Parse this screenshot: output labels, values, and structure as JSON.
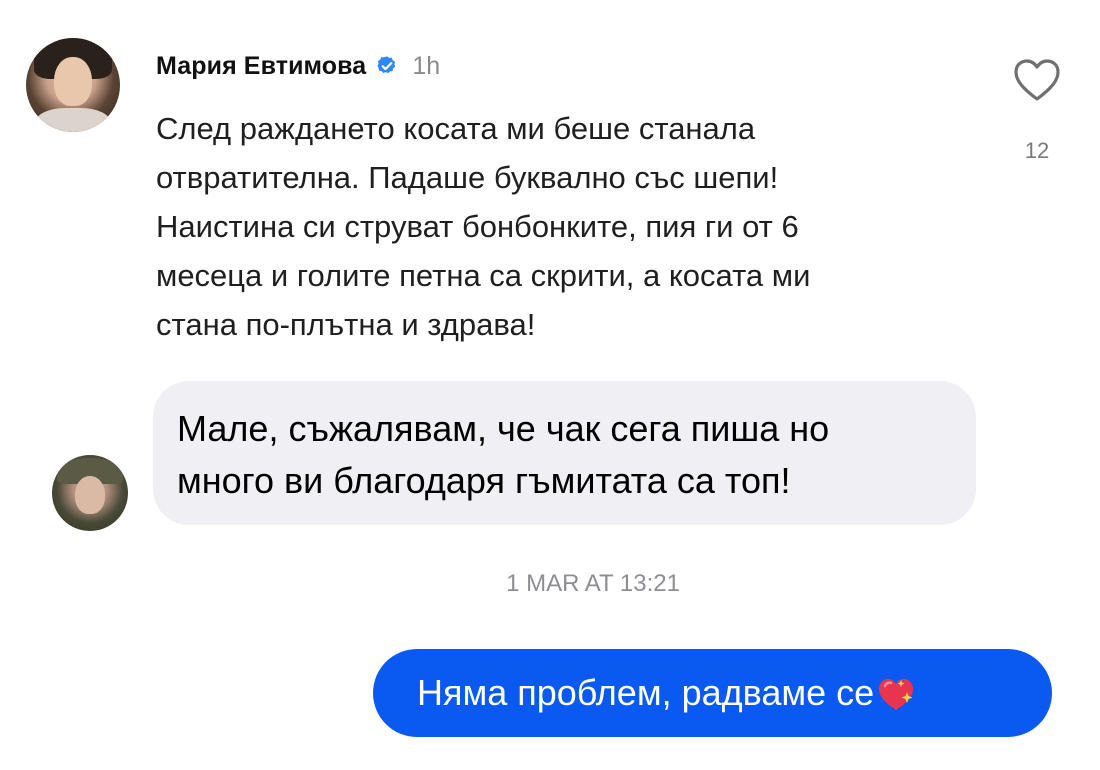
{
  "comment": {
    "author": "Мария Евтимова",
    "time": "1h",
    "text": "След раждането косата ми беше станала\nотвратителна. Падаше буквално със шепи!\nНаистина си струват бонбонките, пия ги от 6\nмесеца и голите петна са скрити, а косата ми\nстана по-плътна и здрава!",
    "like_count": "12",
    "icons": {
      "verified": "verified-badge-icon",
      "like": "heart-outline-icon"
    },
    "colors": {
      "verified": "#2f86f6"
    }
  },
  "messages": {
    "incoming": {
      "text": "Мале, съжалявам, че чак сега пиша но\nмного ви благодаря гъмитата са топ!",
      "bubble_color": "#efeff4"
    },
    "timestamp": "1 MAR AT 13:21",
    "outgoing": {
      "text": "Няма проблем, радваме се",
      "emoji": "sparkling-heart-icon",
      "bubble_color": "#0a59f0"
    }
  }
}
